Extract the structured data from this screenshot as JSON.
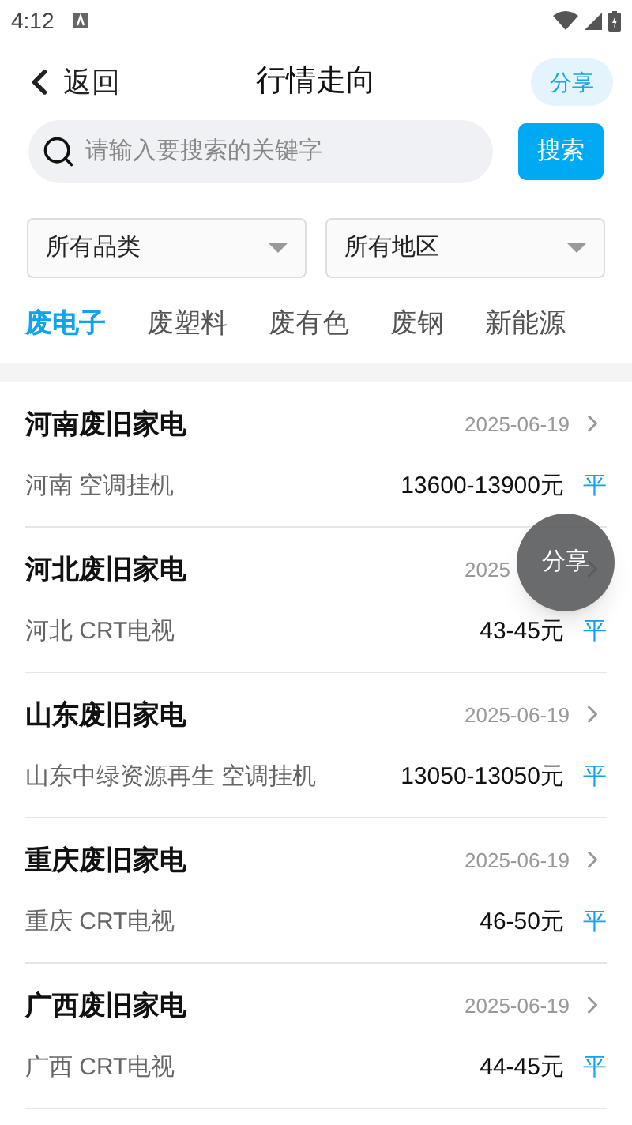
{
  "status_bar": {
    "time": "4:12"
  },
  "header": {
    "back": "返回",
    "title": "行情走向",
    "share": "分享"
  },
  "search": {
    "placeholder": "请输入要搜索的关键字",
    "button": "搜索"
  },
  "filters": [
    {
      "label": "所有品类"
    },
    {
      "label": "所有地区"
    }
  ],
  "tabs": [
    {
      "label": "废电子",
      "selected": true
    },
    {
      "label": "废塑料",
      "selected": false
    },
    {
      "label": "废有色",
      "selected": false
    },
    {
      "label": "废钢",
      "selected": false
    },
    {
      "label": "新能源",
      "selected": false
    }
  ],
  "rows": [
    {
      "title": "河南废旧家电",
      "date": "2025-06-19",
      "detail": "河南 空调挂机",
      "price": "13600-13900元",
      "trend": "平"
    },
    {
      "title": "河北废旧家电",
      "date": "2025",
      "detail": "河北 CRT电视",
      "price": "43-45元",
      "trend": "平"
    },
    {
      "title": "山东废旧家电",
      "date": "2025-06-19",
      "detail": "山东中绿资源再生 空调挂机",
      "price": "13050-13050元",
      "trend": "平"
    },
    {
      "title": "重庆废旧家电",
      "date": "2025-06-19",
      "detail": "重庆 CRT电视",
      "price": "46-50元",
      "trend": "平"
    },
    {
      "title": "广西废旧家电",
      "date": "2025-06-19",
      "detail": "广西 CRT电视",
      "price": "44-45元",
      "trend": "平"
    }
  ],
  "floating_button": {
    "label": "分享"
  }
}
